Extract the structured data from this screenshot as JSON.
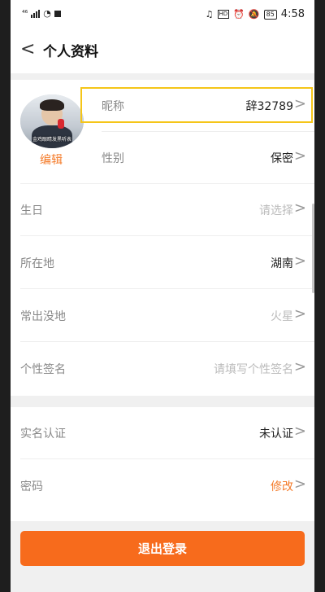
{
  "status_bar": {
    "signal": "⁴⁶",
    "hd": "HD",
    "battery": "85",
    "time": "4:58"
  },
  "header": {
    "back": "<",
    "title": "个人资料"
  },
  "avatar": {
    "caption": "金鸡眼睛发黑听表",
    "edit_label": "编辑"
  },
  "profile_rows": [
    {
      "label": "昵称",
      "value": "辞32789"
    },
    {
      "label": "性别",
      "value": "保密"
    },
    {
      "label": "生日",
      "value": "请选择"
    },
    {
      "label": "所在地",
      "value": "湖南"
    },
    {
      "label": "常出没地",
      "value": "火星"
    },
    {
      "label": "个性签名",
      "value": "请填写个性签名"
    }
  ],
  "account_rows": [
    {
      "label": "实名认证",
      "value": "未认证"
    },
    {
      "label": "密码",
      "value": "修改"
    }
  ],
  "chevron": ">",
  "logout_label": "退出登录",
  "colors": {
    "accent": "#f47b2a",
    "logout_button": "#f76b1c",
    "highlight_border": "#f5c518"
  }
}
